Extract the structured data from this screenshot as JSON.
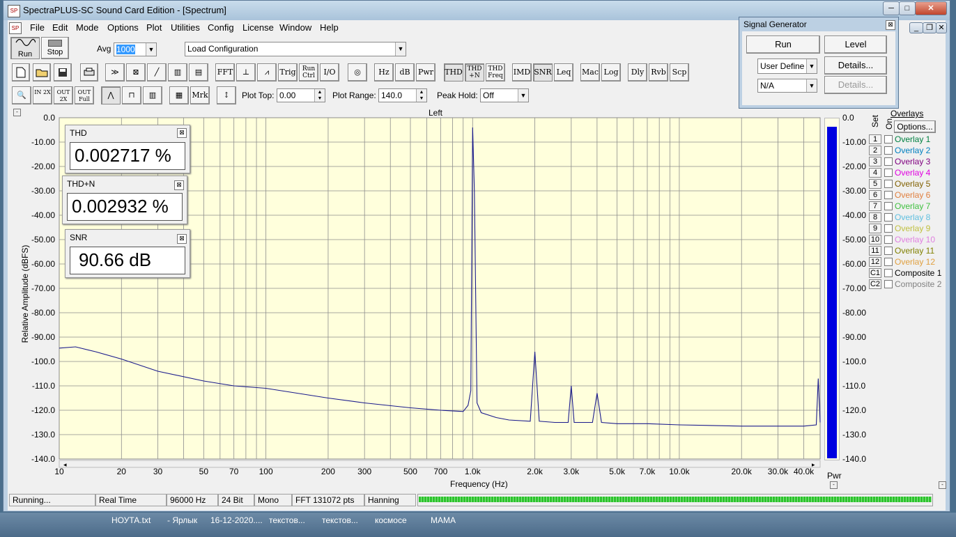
{
  "window": {
    "title": "SpectraPLUS-SC Sound Card Edition - [Spectrum]",
    "app_icon": "spectraplus-icon",
    "controls": [
      "─",
      "□",
      "✕"
    ]
  },
  "menu": [
    "File",
    "Edit",
    "Mode",
    "Options",
    "Plot",
    "Utilities",
    "Config",
    "License",
    "Window",
    "Help"
  ],
  "mdi_controls": [
    "_",
    "❐",
    "✕"
  ],
  "toolbar1": {
    "run_label": "Run",
    "stop_label": "Stop",
    "avg_label": "Avg",
    "avg_value": "1000",
    "config_value": "Load Configuration"
  },
  "toolbar2": {
    "fft": "FFT",
    "trig": "Trig",
    "run_ctrl": "Run Ctrl",
    "io": "I/O",
    "hz": "Hz",
    "db": "dB",
    "pwr": "Pwr",
    "thd": "THD",
    "thdn": "THD +N",
    "thd_freq": "THD Freq",
    "imd": "IMD",
    "snr": "SNR",
    "leq": "Leq",
    "mac": "Mac",
    "log": "Log",
    "dly": "Dly",
    "rvb": "Rvb",
    "scp": "Scp"
  },
  "toolbar3": {
    "in2x": "IN 2X",
    "out2x": "OUT 2X",
    "out_full": "OUT Full",
    "mrk": "Mrk",
    "plot_top_label": "Plot Top:",
    "plot_top_value": "0.00",
    "plot_range_label": "Plot Range:",
    "plot_range_value": "140.0",
    "peak_hold_label": "Peak Hold:",
    "peak_hold_value": "Off"
  },
  "plot": {
    "channel": "Left",
    "ylabel": "Relative Amplitude (dBFS)",
    "xlabel": "Frequency (Hz)",
    "pwr_label": "Pwr"
  },
  "chart_data": {
    "type": "line",
    "title": "Left",
    "xlabel": "Frequency (Hz)",
    "ylabel": "Relative Amplitude (dBFS)",
    "x_scale": "log",
    "xlim": [
      10,
      48000
    ],
    "ylim": [
      -140,
      0
    ],
    "grid": true,
    "x_ticks": [
      "10",
      "20",
      "30",
      "50",
      "70",
      "100",
      "200",
      "300",
      "500",
      "700",
      "1.0k",
      "2.0k",
      "3.0k",
      "5.0k",
      "7.0k",
      "10.0k",
      "20.0k",
      "30.0k",
      "40.0k"
    ],
    "x_tick_values": [
      10,
      20,
      30,
      50,
      70,
      100,
      200,
      300,
      500,
      700,
      1000,
      2000,
      3000,
      5000,
      7000,
      10000,
      20000,
      30000,
      40000
    ],
    "y_ticks": [
      "0.0",
      "-10.00",
      "-20.00",
      "-30.00",
      "-40.00",
      "-50.00",
      "-60.00",
      "-70.00",
      "-80.00",
      "-90.00",
      "-100.0",
      "-110.0",
      "-120.0",
      "-130.0",
      "-140.0"
    ],
    "y_tick_values": [
      0,
      -10,
      -20,
      -30,
      -40,
      -50,
      -60,
      -70,
      -80,
      -90,
      -100,
      -110,
      -120,
      -130,
      -140
    ],
    "series": [
      {
        "color": "#1a1a8c",
        "x": [
          10,
          12,
          15,
          20,
          30,
          50,
          70,
          100,
          200,
          300,
          500,
          700,
          900,
          950,
          980,
          1000,
          1020,
          1050,
          1100,
          1300,
          1500,
          1900,
          2000,
          2100,
          2500,
          2900,
          3000,
          3100,
          3800,
          4000,
          4200,
          5000,
          7000,
          10000,
          20000,
          30000,
          40000,
          46000,
          47000,
          48000
        ],
        "y": [
          -94.5,
          -94,
          -96,
          -99,
          -104,
          -108,
          -110,
          -111,
          -115,
          -117,
          -119,
          -120,
          -120.5,
          -118,
          -112,
          -4,
          -30,
          -117,
          -121,
          -123,
          -124,
          -124.5,
          -96,
          -124.5,
          -125,
          -125,
          -110,
          -125,
          -125,
          -113,
          -125,
          -125.5,
          -125.5,
          -126,
          -126.5,
          -126.5,
          -126.5,
          -126,
          -107,
          -125
        ]
      }
    ],
    "meter": {
      "label": "Pwr",
      "value_db": -3
    }
  },
  "readouts": [
    {
      "title": "THD",
      "value": "0.002717 %"
    },
    {
      "title": "THD+N",
      "value": "0.002932 %"
    },
    {
      "title": "SNR",
      "value": "90.66 dB"
    }
  ],
  "overlays": {
    "title": "Overlays",
    "set_label": "Set",
    "on_label": "On",
    "options_label": "Options...",
    "items": [
      {
        "set": "1",
        "name": "Overlay 1",
        "color": "#008040"
      },
      {
        "set": "2",
        "name": "Overlay 2",
        "color": "#0080c0"
      },
      {
        "set": "3",
        "name": "Overlay 3",
        "color": "#800080"
      },
      {
        "set": "4",
        "name": "Overlay 4",
        "color": "#e000e0"
      },
      {
        "set": "5",
        "name": "Overlay 5",
        "color": "#806000"
      },
      {
        "set": "6",
        "name": "Overlay 6",
        "color": "#e08040"
      },
      {
        "set": "7",
        "name": "Overlay 7",
        "color": "#40c040"
      },
      {
        "set": "8",
        "name": "Overlay 8",
        "color": "#60c0e0"
      },
      {
        "set": "9",
        "name": "Overlay 9",
        "color": "#c0c040"
      },
      {
        "set": "10",
        "name": "Overlay 10",
        "color": "#e080e0"
      },
      {
        "set": "11",
        "name": "Overlay 11",
        "color": "#808000"
      },
      {
        "set": "12",
        "name": "Overlay 12",
        "color": "#e0a040"
      },
      {
        "set": "C1",
        "name": "Composite 1",
        "color": "#000000"
      },
      {
        "set": "C2",
        "name": "Composite 2",
        "color": "#808080"
      }
    ]
  },
  "status": {
    "state": "Running...",
    "mode": "Real Time",
    "rate": "96000 Hz",
    "bits": "24 Bit",
    "channels": "Mono",
    "fft": "FFT 131072 pts",
    "window": "Hanning"
  },
  "siggen": {
    "title": "Signal Generator",
    "run": "Run",
    "level": "Level",
    "type": "User Define",
    "details1": "Details...",
    "sub": "N/A",
    "details2": "Details..."
  },
  "taskbar": [
    "НОУТА.txt",
    "- Ярлык",
    "16-12-2020....",
    "текстов...",
    "текстов...",
    "космосе",
    "МАМА"
  ]
}
